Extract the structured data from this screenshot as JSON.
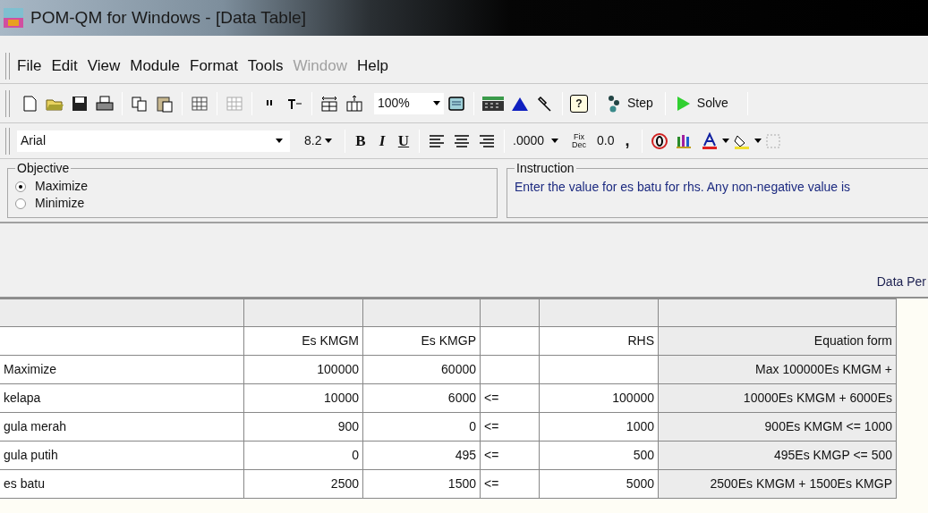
{
  "window": {
    "title": "POM-QM for Windows - [Data Table]"
  },
  "menu": [
    {
      "label": "File",
      "disabled": false
    },
    {
      "label": "Edit",
      "disabled": false
    },
    {
      "label": "View",
      "disabled": false
    },
    {
      "label": "Module",
      "disabled": false
    },
    {
      "label": "Format",
      "disabled": false
    },
    {
      "label": "Tools",
      "disabled": false
    },
    {
      "label": "Window",
      "disabled": true
    },
    {
      "label": "Help",
      "disabled": false
    }
  ],
  "toolbar": {
    "zoom": "100%",
    "help": "?",
    "step": "Step",
    "solve": "Solve"
  },
  "format_bar": {
    "font": "Arial",
    "size": "8.2",
    "bold": "B",
    "italic": "I",
    "underline": "U",
    "number_format": ".0000",
    "fix": "Fix",
    "dec": "Dec",
    "decimal": "0.0",
    "comma": ","
  },
  "objective": {
    "title": "Objective",
    "options": [
      {
        "label": "Maximize",
        "selected": true
      },
      {
        "label": "Minimize",
        "selected": false
      }
    ]
  },
  "instruction": {
    "title": "Instruction",
    "text": "Enter the value for es batu for rhs. Any non-negative value is"
  },
  "data_bar": "Data Per",
  "table": {
    "columns": [
      "",
      "Es KMGM",
      "Es KMGP",
      "",
      "RHS",
      "Equation form"
    ],
    "rows": [
      [
        "Maximize",
        "100000",
        "60000",
        "",
        "",
        "Max  100000Es KMGM +"
      ],
      [
        "kelapa",
        "10000",
        "6000",
        "<=",
        "100000",
        "10000Es KMGM +  6000Es"
      ],
      [
        "gula merah",
        "900",
        "0",
        "<=",
        "1000",
        "900Es KMGM <= 1000"
      ],
      [
        "gula putih",
        "0",
        "495",
        "<=",
        "500",
        "495Es KMGP <= 500"
      ],
      [
        "es batu",
        "2500",
        "1500",
        "<=",
        "5000",
        "2500Es KMGM +  1500Es KMGP"
      ]
    ]
  }
}
